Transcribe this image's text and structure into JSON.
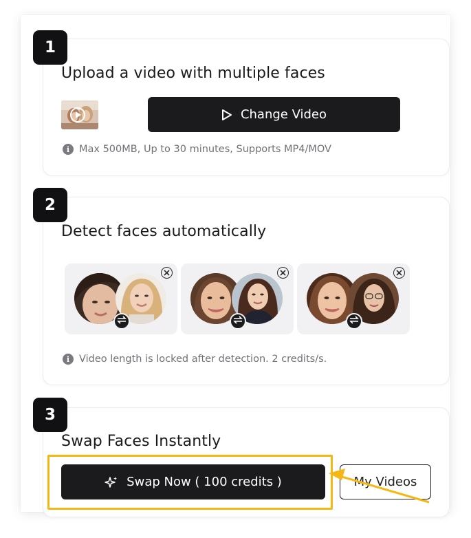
{
  "steps": [
    {
      "number": "1",
      "title": "Upload a video with multiple faces",
      "button_label": "Change Video",
      "hint": "Max 500MB, Up to 30 minutes, Supports MP4/MOV"
    },
    {
      "number": "2",
      "title": "Detect faces automatically",
      "hint": "Video length is locked after detection. 2 credits/s."
    },
    {
      "number": "3",
      "title": "Swap Faces Instantly",
      "primary_label": "Swap Now ( 100 credits )",
      "secondary_label": "My Videos"
    }
  ],
  "face_pairs": [
    {
      "source": "detected-face-1",
      "target": "replacement-face-1"
    },
    {
      "source": "detected-face-2",
      "target": "replacement-face-2"
    },
    {
      "source": "detected-face-3",
      "target": "replacement-face-3"
    }
  ],
  "icons": {
    "play": "play-icon",
    "info": "info-icon",
    "remove": "close-circle-icon",
    "swap": "swap-arrows-icon",
    "sparkle": "sparkle-icon"
  },
  "colors": {
    "primary_button": "#1b1b1d",
    "highlight": "#f5b812",
    "hint_text": "#707077"
  }
}
